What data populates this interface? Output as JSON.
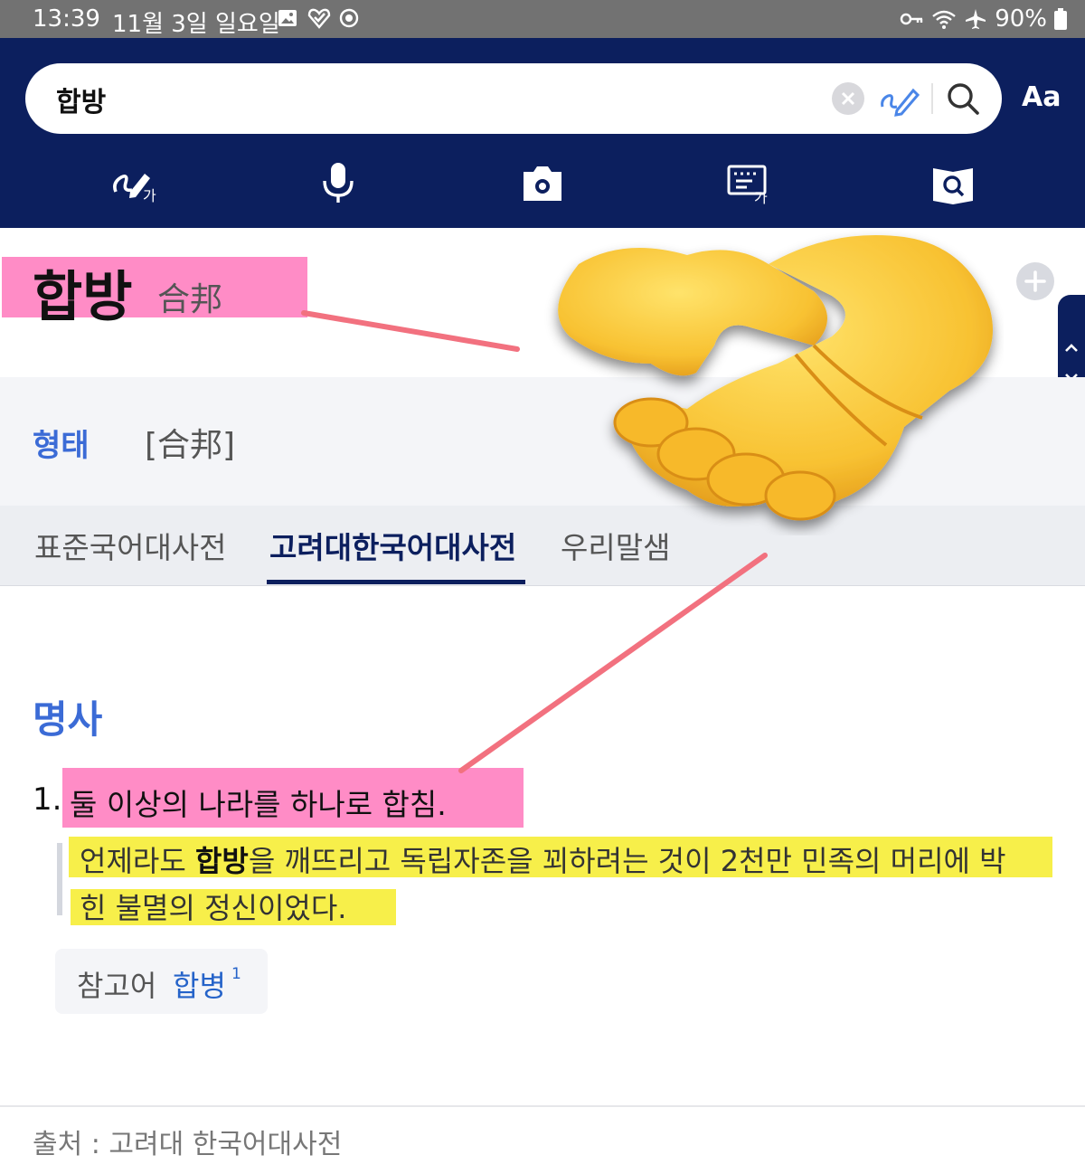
{
  "status_bar": {
    "time": "13:39",
    "date": "11월 3일 일요일",
    "battery": "90%",
    "left_icons": [
      "image-icon",
      "vpn-heart-icon",
      "sync-icon"
    ],
    "right_icons": [
      "key-icon",
      "wifi-icon",
      "airplane-icon",
      "battery-icon"
    ]
  },
  "header": {
    "search_query": "합방",
    "font_size_button": "Aa",
    "tool_icons": [
      "handwriting-icon",
      "microphone-icon",
      "camera-icon",
      "keyboard-icon",
      "book-search-icon"
    ]
  },
  "entry": {
    "headword": "합방",
    "hanja": "合邦",
    "form_label": "형태",
    "form_value": "[合邦]",
    "tabs": [
      {
        "label": "표준국어대사전",
        "active": false
      },
      {
        "label": "고려대한국어대사전",
        "active": true
      },
      {
        "label": "우리말샘",
        "active": false
      }
    ],
    "part_of_speech": "명사",
    "sense_number": "1.",
    "definition": "둘 이상의 나라를 하나로 합침.",
    "example_before": "언제라도 ",
    "example_bold": "합방",
    "example_after": "을 깨뜨리고 독립자존을 꾀하려는 것이 2천만 민족의 머리에 박",
    "example_line2": "힌 불멸의 정신이었다.",
    "reference_label": "참고어",
    "reference_word": "합병",
    "reference_sup": "1"
  },
  "footer": {
    "source": "출처 : 고려대 한국어대사전"
  },
  "colors": {
    "header_navy": "#0c1f5e",
    "accent_blue": "#3b6bd6",
    "highlight_pink": "#ff8cc6",
    "highlight_yellow": "#f7ef4a",
    "annotation_line": "#f2717f"
  }
}
